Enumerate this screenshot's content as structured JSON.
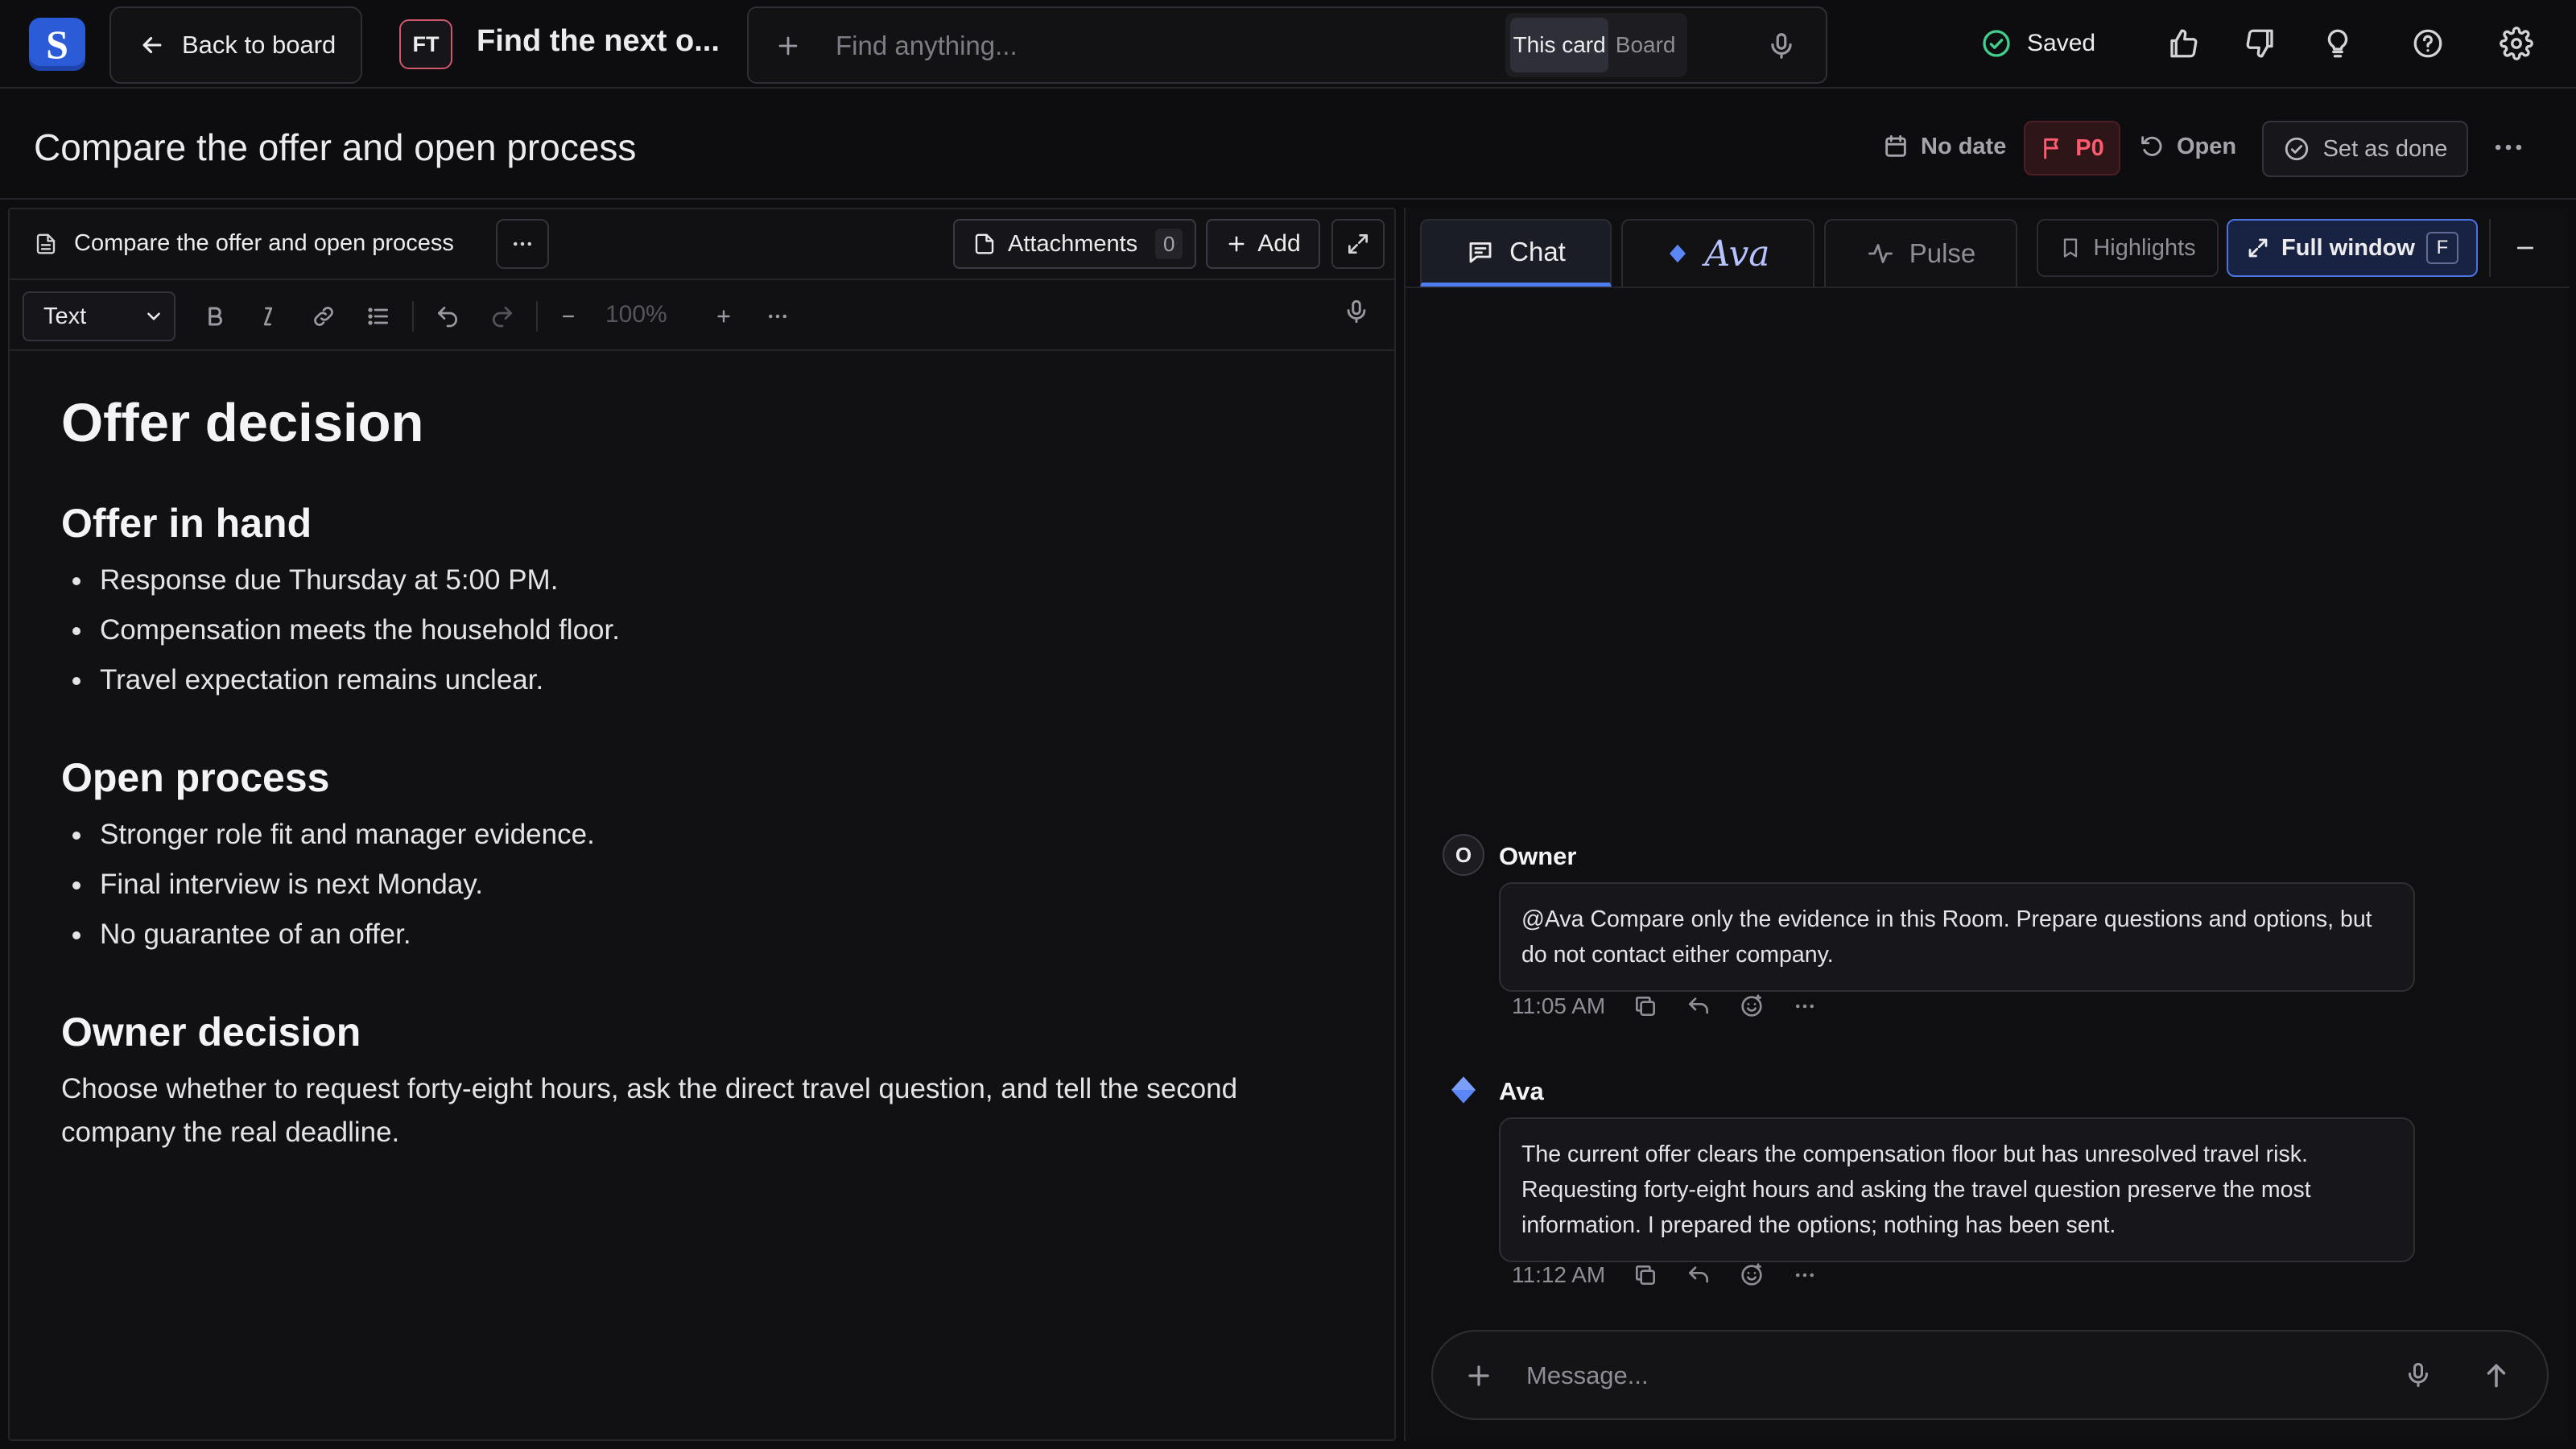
{
  "app": {
    "logo_letter": "S",
    "brand_color": "#2b5bd7"
  },
  "topbar": {
    "back_label": "Back to board",
    "card_badge": "FT",
    "card_short_title": "Find the next o...",
    "search_placeholder": "Find anything...",
    "scope_options": [
      "This card",
      "Board"
    ],
    "scope_selected": "This card",
    "save_status": "Saved"
  },
  "title_bar": {
    "title": "Compare the offer and open process",
    "date": "No date",
    "priority": "P0",
    "status": "Open",
    "set_done_label": "Set as done"
  },
  "doc_panel": {
    "doc_name": "Compare the offer and open process",
    "attachments_label": "Attachments",
    "attachments_count": "0",
    "add_label": "Add",
    "text_style": "Text",
    "zoom": "100%"
  },
  "document": {
    "h1": "Offer decision",
    "section1": {
      "heading": "Offer in hand",
      "items": [
        "Response due Thursday at 5:00 PM.",
        "Compensation meets the household floor.",
        "Travel expectation remains unclear."
      ]
    },
    "section2": {
      "heading": "Open process",
      "items": [
        "Stronger role fit and manager evidence.",
        "Final interview is next Monday.",
        "No guarantee of an offer."
      ]
    },
    "section3": {
      "heading": "Owner decision",
      "paragraph": "Choose whether to request forty-eight hours, ask the direct travel question, and tell the second company the real deadline."
    }
  },
  "chat_panel": {
    "tabs": {
      "chat": "Chat",
      "ava": "Ava",
      "pulse": "Pulse"
    },
    "highlights_label": "Highlights",
    "full_window_label": "Full window",
    "full_window_key": "F",
    "messages": [
      {
        "avatar": "O",
        "author": "Owner",
        "text": "@Ava Compare only the evidence in this Room. Prepare questions and options, but do not contact either company.",
        "time": "11:05 AM"
      },
      {
        "author": "Ava",
        "text": "The current offer clears the compensation floor but has unresolved travel risk. Requesting forty-eight hours and asking the travel question preserve the most information. I prepared the options; nothing has been sent.",
        "time": "11:12 AM"
      }
    ],
    "composer_placeholder": "Message..."
  },
  "colors": {
    "accent": "#4d7df0",
    "priority": "#ff5a6e",
    "saved": "#3fcf8e"
  }
}
